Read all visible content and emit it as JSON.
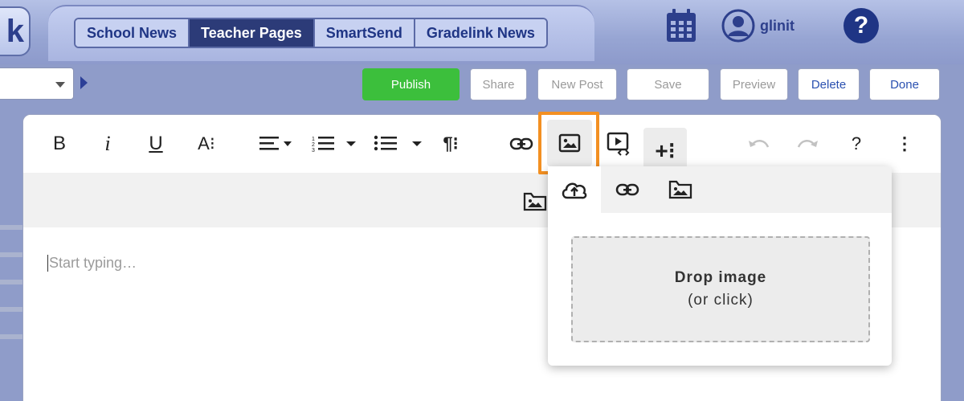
{
  "header": {
    "logo_fragment": "k",
    "tabs": [
      {
        "label": "School News",
        "active": false
      },
      {
        "label": "Teacher Pages",
        "active": true
      },
      {
        "label": "SmartSend",
        "active": false
      },
      {
        "label": "Gradelink News",
        "active": false
      }
    ],
    "user_name": "glinit",
    "help_glyph": "?"
  },
  "actions": {
    "publish": "Publish",
    "share": "Share",
    "new_post": "New Post",
    "save": "Save",
    "preview": "Preview",
    "delete": "Delete",
    "done": "Done"
  },
  "toolbar": {
    "bold": "B",
    "italic": "i",
    "underline": "U",
    "font_size": "A⁝",
    "paragraph": "¶⁝",
    "help": "?",
    "more": "⋮",
    "plus": "+⁝"
  },
  "editor": {
    "placeholder": "Start typing…"
  },
  "image_popup": {
    "tabs": [
      "upload",
      "by-url",
      "browse"
    ],
    "drop_title": "Drop image",
    "drop_sub": "(or click)"
  },
  "colors": {
    "nav_active": "#2c3b78",
    "publish_green": "#3cbf3c",
    "highlight_orange": "#f39022",
    "brand_blue": "#1f3585"
  }
}
